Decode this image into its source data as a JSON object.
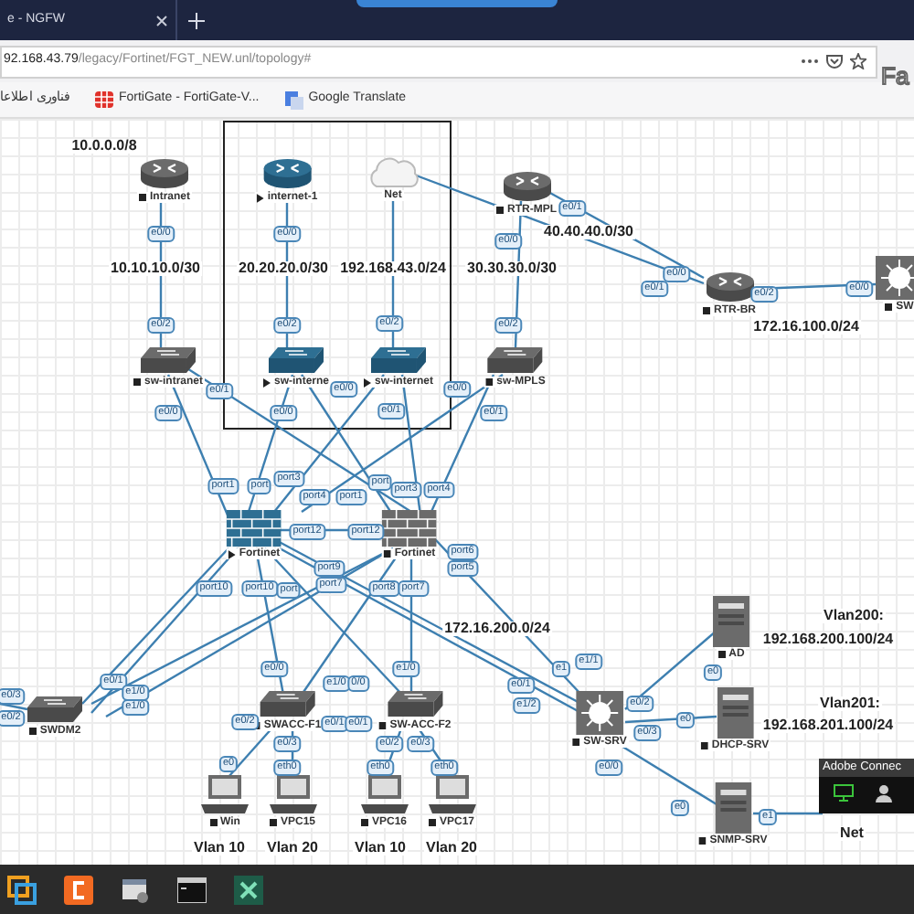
{
  "browser": {
    "tab": {
      "title": "e - NGFW"
    },
    "url": {
      "host": "92.168.43.79",
      "path": "/legacy/Fortinet/FGT_NEW.unl/topology#"
    },
    "bookmarks": [
      {
        "label": "فناوری اطلاعا",
        "kind": "plain"
      },
      {
        "label": "FortiGate - FortiGate-V...",
        "kind": "fortigate"
      },
      {
        "label": "Google Translate",
        "kind": "translate"
      }
    ],
    "logo_text": "Fa"
  },
  "topology": {
    "nodes": [
      {
        "name": "Intranet",
        "kind": "router",
        "running": false
      },
      {
        "name": "internet-1",
        "kind": "router",
        "running": true
      },
      {
        "name": "Net",
        "kind": "cloud"
      },
      {
        "name": "RTR-MPL",
        "kind": "router",
        "running": false
      },
      {
        "name": "RTR-BR",
        "kind": "router",
        "running": false
      },
      {
        "name": "SW",
        "kind": "l3switch",
        "running": false
      },
      {
        "name": "sw-intranet",
        "kind": "switch",
        "running": false
      },
      {
        "name": "sw-interne",
        "kind": "switch",
        "running": true
      },
      {
        "name": "sw-internet",
        "kind": "switch",
        "running": true
      },
      {
        "name": "sw-MPLS",
        "kind": "switch",
        "running": false
      },
      {
        "name": "Fortinet",
        "kind": "firewall",
        "running": true
      },
      {
        "name": "Fortinet",
        "kind": "firewall",
        "running": false
      },
      {
        "name": "SWDM2",
        "kind": "switch",
        "running": false
      },
      {
        "name": "SWACC-F1",
        "kind": "switch",
        "running": false
      },
      {
        "name": "SW-ACC-F2",
        "kind": "switch",
        "running": false
      },
      {
        "name": "SW-SRV",
        "kind": "l3switch",
        "running": false
      },
      {
        "name": "AD",
        "kind": "server",
        "running": false
      },
      {
        "name": "DHCP-SRV",
        "kind": "server",
        "running": false
      },
      {
        "name": "SNMP-SRV",
        "kind": "server",
        "running": false
      },
      {
        "name": "Win",
        "kind": "pc",
        "running": false
      },
      {
        "name": "VPC15",
        "kind": "pc",
        "running": false
      },
      {
        "name": "VPC16",
        "kind": "pc",
        "running": false
      },
      {
        "name": "VPC17",
        "kind": "pc",
        "running": false
      }
    ],
    "ports": [
      "e0/0",
      "e0/2",
      "e0/1",
      "e0/0",
      "e0/0",
      "e0/2",
      "e0/0",
      "e0/0",
      "e0/2",
      "e0/1",
      "e0/0",
      "e0/1",
      "e0/0",
      "e0/2",
      "e0/1",
      "e0/0",
      "e0/1",
      "e0/2",
      "e0/0",
      "port1",
      "port",
      "port3",
      "port4",
      "port1",
      "port",
      "port3",
      "port4",
      "port12",
      "port12",
      "port6",
      "port5",
      "port9",
      "port10",
      "port10",
      "port",
      "port7",
      "port8",
      "port7",
      "e0/3",
      "e0/2",
      "e0/1",
      "e1/0",
      "e1/0",
      "e0/0",
      "e1/0",
      "0/0",
      "e1/0",
      "e0/2",
      "e0/1",
      "e0/1",
      "e0/3",
      "e0/2",
      "e0/3",
      "e0",
      "eth0",
      "eth0",
      "eth0",
      "e1/1",
      "e1",
      "e0/1",
      "e1/2",
      "e0/2",
      "e0/3",
      "e0",
      "e0",
      "e0/0",
      "e0",
      "e1"
    ],
    "network_labels": [
      "10.0.0.0/8",
      "10.10.10.0/30",
      "20.20.20.0/30",
      "192.168.43.0/24",
      "30.30.30.0/30",
      "40.40.40.0/30",
      "172.16.100.0/24",
      "172.16.200.0/24",
      "Vlan200:",
      "192.168.200.100/24",
      "Vlan201:",
      "192.168.201.100/24",
      "Vlan 10",
      "Vlan 20",
      "Vlan 10",
      "Vlan 20",
      "Net"
    ]
  },
  "popup": {
    "title": "Adobe Connec"
  }
}
